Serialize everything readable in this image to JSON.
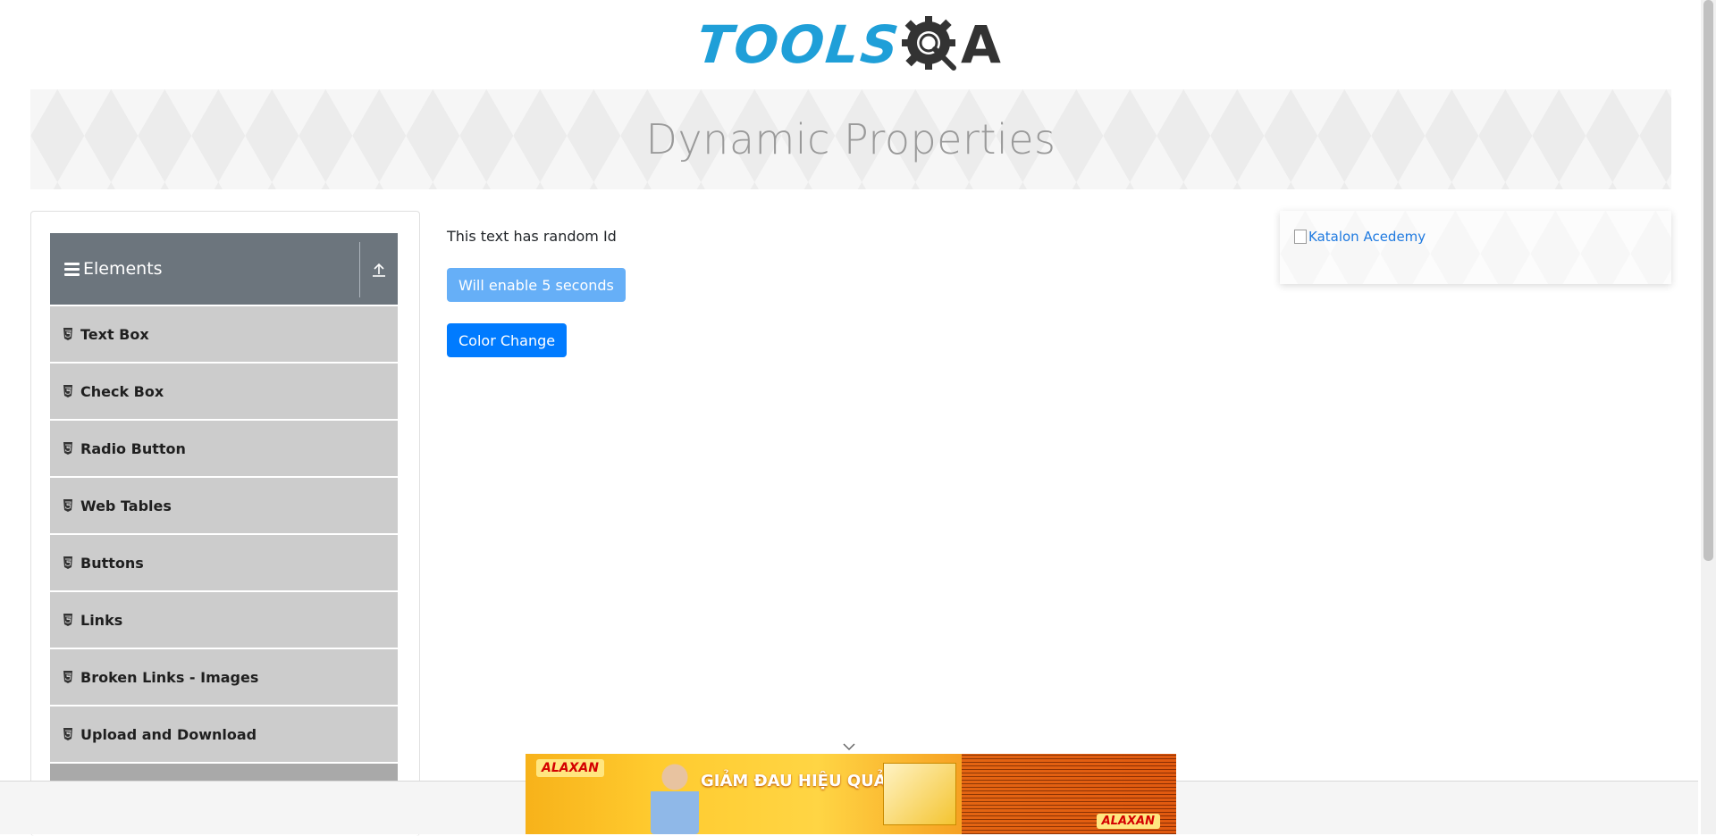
{
  "header": {
    "logo_tools": "TOOLS",
    "logo_qa_letter": "A"
  },
  "banner": {
    "title": "Dynamic Properties"
  },
  "sidebar": {
    "group_title": "Elements",
    "items": [
      {
        "label": "Text Box"
      },
      {
        "label": "Check Box"
      },
      {
        "label": "Radio Button"
      },
      {
        "label": "Web Tables"
      },
      {
        "label": "Buttons"
      },
      {
        "label": "Links"
      },
      {
        "label": "Broken Links - Images"
      },
      {
        "label": "Upload and Download"
      }
    ]
  },
  "main": {
    "random_text": "This text has random Id",
    "enable_button_label": "Will enable 5 seconds",
    "color_change_button_label": "Color Change"
  },
  "ad_card": {
    "link_text": "Katalon Acedemy"
  },
  "bottom_ad": {
    "brand": "ALAXAN",
    "headline": "GIẢM ĐAU HIỆU QUẢ*",
    "brand_right": "ALAXAN"
  },
  "colors": {
    "logo_blue": "#1f9fd8",
    "header_gray": "#6c757d",
    "menu_item_bg": "#cccccc",
    "primary_button": "#007bff",
    "disabled_button": "#66aff7"
  }
}
